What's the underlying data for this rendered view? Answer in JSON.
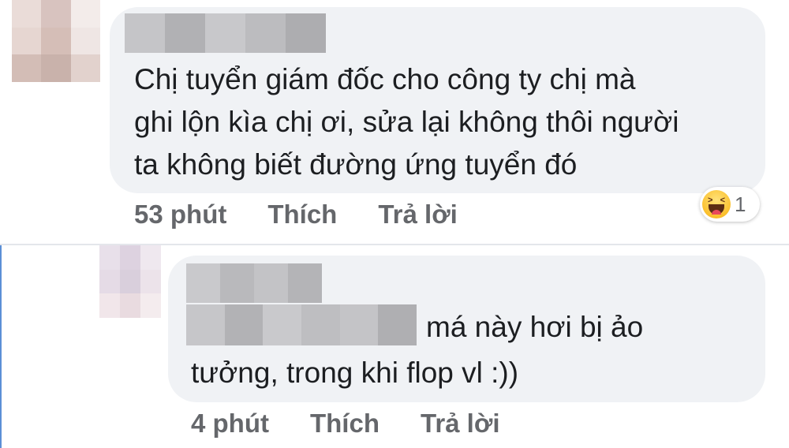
{
  "comments": [
    {
      "text": "Chị tuyển giám đốc cho công ty chị mà\nghi lộn kìa chị ơi, sửa lại không thôi người\nta không biết đường ứng tuyển đó",
      "time": "53 phút",
      "like_label": "Thích",
      "reply_label": "Trả lời",
      "reaction": {
        "icon": "haha-icon",
        "count": "1"
      }
    }
  ],
  "reply": {
    "text_line1": "má này hơi bị ảo",
    "text_line2": "tưởng, trong khi flop vl :))",
    "time": "4 phút",
    "like_label": "Thích",
    "reply_label": "Trả lời"
  },
  "colors": {
    "bubble": "#f0f2f5",
    "text": "#1c1e21",
    "meta": "#65676b",
    "reply_edge": "#5b8fd6"
  }
}
